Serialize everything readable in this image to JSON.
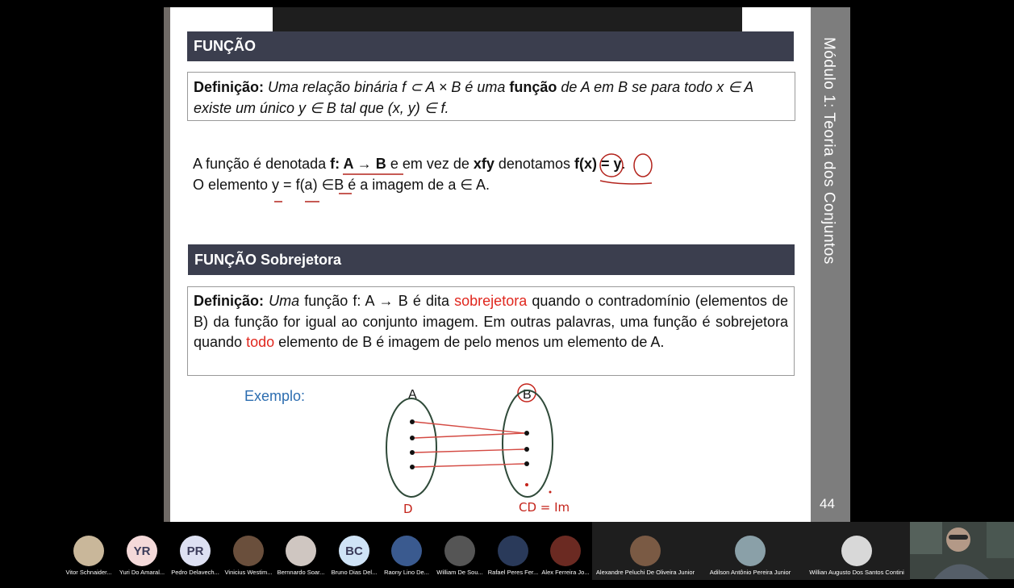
{
  "slide": {
    "header1": "FUNÇÃO",
    "def1_label": "Definição:",
    "def1_line1_a": " Uma relação binária f ⊂ A × B é uma ",
    "def1_line1_b": "função",
    "def1_line1_c": " de A em B se para todo x ∈ A",
    "def1_line2": "existe um único y ∈ B tal que (x, y) ∈ f.",
    "line1_a": "A função é denotada ",
    "line1_b": "f: A → B",
    "line1_c": " e em vez de ",
    "line1_d": "xfy",
    "line1_e": " denotamos ",
    "line1_f": "f(x) = y",
    "line1_g": ".",
    "line2": "O elemento y = f(a)  ∈B é a imagem de a ∈ A.",
    "header2": "FUNÇÃO Sobrejetora",
    "def2_label": "Definição:",
    "def2_a": " Uma",
    "def2_b": " função f: A → B é dita ",
    "def2_c": "sobrejetora",
    "def2_d": " quando o contradomínio (elementos de B) da função for igual ao conjunto imagem. Em outras palavras, uma função é sobrejetora quando ",
    "def2_e": "todo",
    "def2_f": " elemento de B é imagem de pelo menos um elemento de A.",
    "exemplo": "Exemplo:",
    "set_a": "A",
    "set_b": "B",
    "hand_d": "D",
    "hand_cd": "CD = Im",
    "side_title": "Módulo 1: Teoria dos Conjuntos",
    "page_number": "44"
  },
  "participants": [
    {
      "name": "Vitor Schnaider...",
      "initials": "",
      "color": "#c9b79a"
    },
    {
      "name": "Yuri Do Amaral...",
      "initials": "YR",
      "color": "#f4d9d9"
    },
    {
      "name": "Pedro Delavech...",
      "initials": "PR",
      "color": "#dde0f2"
    },
    {
      "name": "Vinicius Westim...",
      "initials": "",
      "color": "#6a4f3c"
    },
    {
      "name": "Bernnardo Soar...",
      "initials": "",
      "color": "#cfc6c1"
    },
    {
      "name": "Bruno Dias Del...",
      "initials": "BC",
      "color": "#cfe3f6"
    },
    {
      "name": "Raony Lino De...",
      "initials": "",
      "color": "#3a5a8f"
    },
    {
      "name": "William De Sou...",
      "initials": "",
      "color": "#555"
    },
    {
      "name": "Rafael Peres Fer...",
      "initials": "",
      "color": "#2a3a5a"
    },
    {
      "name": "Alex Ferreira Jo...",
      "initials": "",
      "color": "#6b2a22"
    },
    {
      "name": "Alexandre Peluchi De Oliveira Junior",
      "initials": "",
      "color": "#7a5a44"
    },
    {
      "name": "Adilson Antônio Pereira Junior",
      "initials": "",
      "color": "#8aa0a8"
    },
    {
      "name": "Willian Augusto Dos Santos Contini",
      "initials": "",
      "color": "#d8d8d8"
    }
  ]
}
